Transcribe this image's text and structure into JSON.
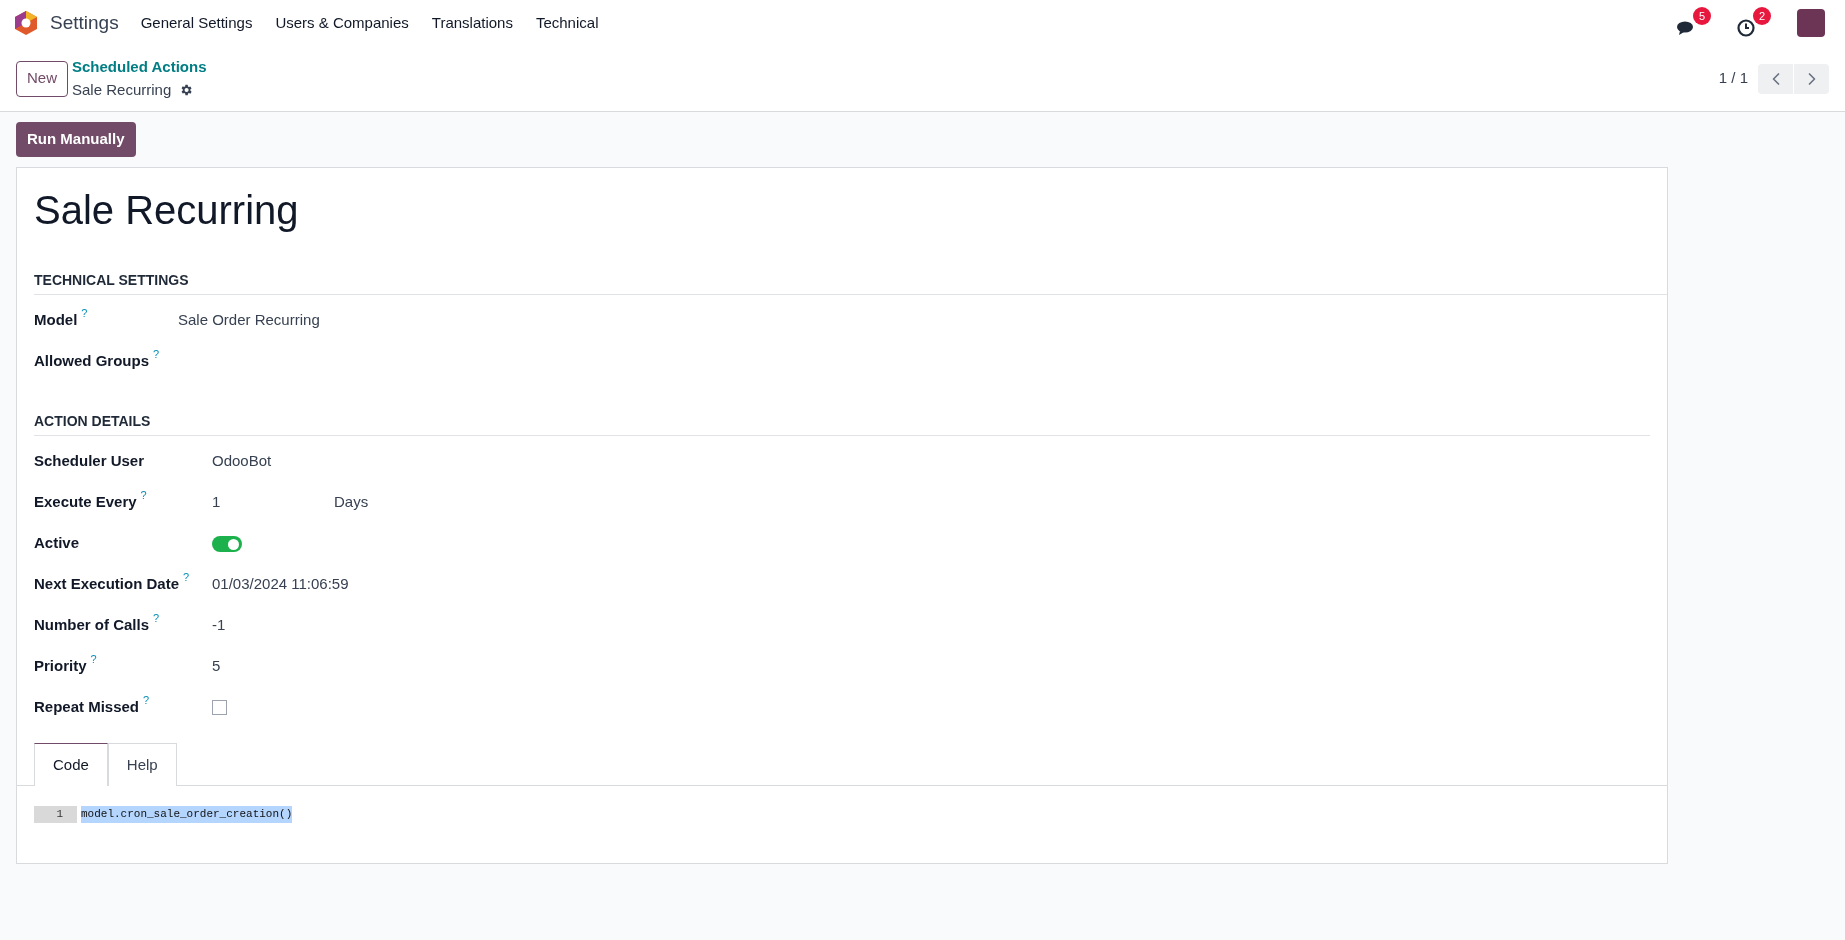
{
  "navbar": {
    "app_name": "Settings",
    "menu": [
      "General Settings",
      "Users & Companies",
      "Translations",
      "Technical"
    ],
    "messages_badge": "5",
    "activities_badge": "2"
  },
  "control_panel": {
    "new_button": "New",
    "breadcrumb_parent": "Scheduled Actions",
    "breadcrumb_current": "Sale Recurring",
    "pager": "1 / 1"
  },
  "action_button": "Run Manually",
  "form": {
    "title": "Sale Recurring",
    "sections": [
      {
        "heading": "TECHNICAL SETTINGS",
        "fields": [
          {
            "kind": "text",
            "label": "Model",
            "help": "?",
            "value": "Sale Order Recurring"
          },
          {
            "kind": "text",
            "label": "Allowed Groups",
            "help": "?"
          }
        ]
      },
      {
        "heading": "ACTION DETAILS",
        "fields": [
          {
            "kind": "text",
            "label": "Scheduler User",
            "value": "OdooBot"
          },
          {
            "kind": "interval",
            "label": "Execute Every",
            "help": "?",
            "value": "1",
            "unit": "Days"
          },
          {
            "kind": "toggle",
            "label": "Active",
            "on": true
          },
          {
            "kind": "text",
            "label": "Next Execution Date",
            "help": "?",
            "value": "01/03/2024 11:06:59"
          },
          {
            "kind": "text",
            "label": "Number of Calls",
            "help": "?",
            "value": "-1"
          },
          {
            "kind": "text",
            "label": "Priority",
            "help": "?",
            "value": "5"
          },
          {
            "kind": "checkbox",
            "label": "Repeat Missed",
            "help": "?",
            "checked": false
          }
        ]
      }
    ],
    "tabs": [
      {
        "label": "Code",
        "selected": true
      },
      {
        "label": "Help",
        "selected": false
      }
    ],
    "code": [
      {
        "line_number": "1",
        "text": "model.cron_sale_order_creation()"
      }
    ]
  }
}
